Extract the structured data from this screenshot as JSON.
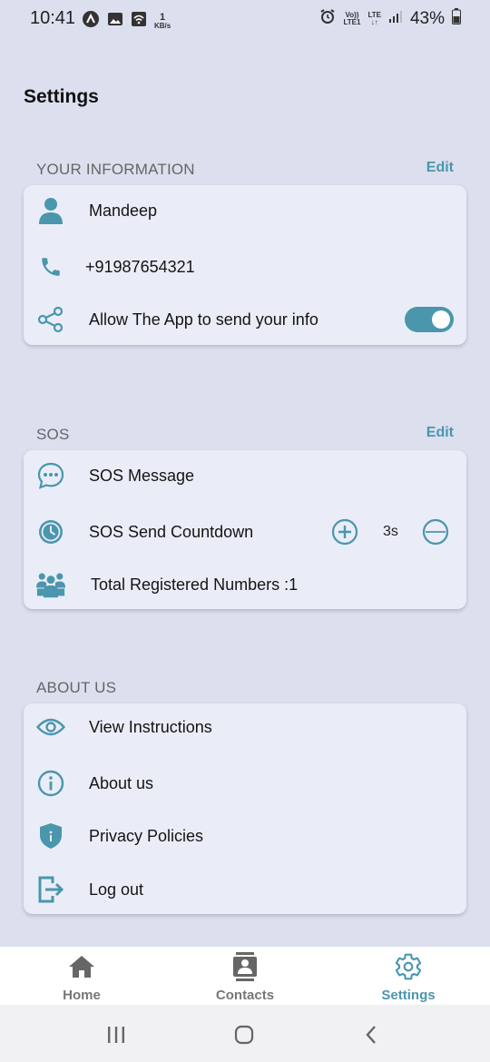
{
  "status_bar": {
    "time": "10:41",
    "net_speed_value": "1",
    "net_speed_unit": "KB/s",
    "volte_top": "Vo))",
    "volte_bottom": "LTE1",
    "lte_top": "LTE",
    "lte_bottom": "↓↑",
    "battery": "43%"
  },
  "page": {
    "title": "Settings"
  },
  "your_info": {
    "label": "YOUR INFORMATION",
    "edit": "Edit",
    "name": "Mandeep",
    "phone": "+91987654321",
    "share_label": "Allow The App to send your info",
    "share_enabled": true
  },
  "sos": {
    "label": "SOS",
    "edit": "Edit",
    "message_label": "SOS Message",
    "countdown_label": "SOS Send Countdown",
    "countdown_value": "3s",
    "registered_label": "Total Registered Numbers :1"
  },
  "about": {
    "label": "ABOUT US",
    "instructions": "View Instructions",
    "about_us": "About us",
    "privacy": "Privacy Policies",
    "logout": "Log out"
  },
  "bottom_nav": {
    "items": [
      {
        "label": "Home",
        "icon": "home-icon"
      },
      {
        "label": "Contacts",
        "icon": "contacts-icon"
      },
      {
        "label": "Settings",
        "icon": "settings-icon",
        "active": true
      }
    ]
  },
  "colors": {
    "accent": "#4a96ad",
    "background": "#dcdfee",
    "card": "#eaedf7"
  }
}
